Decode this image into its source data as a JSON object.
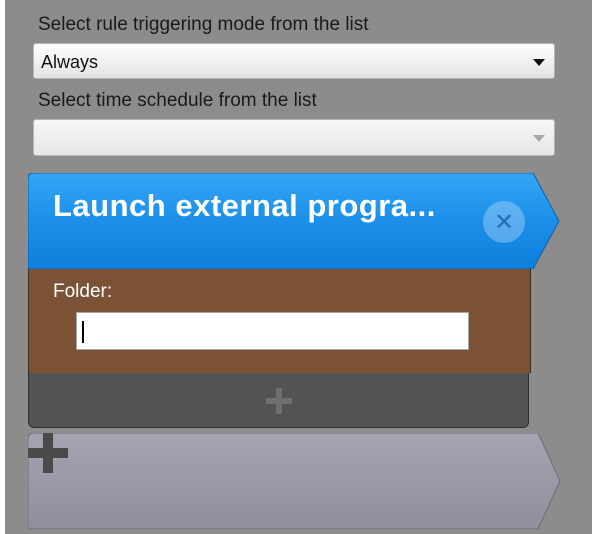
{
  "header": {
    "mode_label": "Select rule triggering mode from the list",
    "schedule_label": "Select time schedule from the list"
  },
  "mode_select": {
    "value": "Always"
  },
  "schedule_select": {
    "value": ""
  },
  "action_card": {
    "title": "Launch external progra...",
    "folder_label": "Folder:",
    "folder_value": ""
  },
  "icons": {
    "close": "close-icon",
    "add_small": "plus-icon",
    "add_big": "plus-icon"
  },
  "colors": {
    "panel": "#8c8c8c",
    "card_header": "#1a8fe8",
    "card_body": "#7b5236",
    "card_footer": "#535353",
    "add_block": "#9a9aa6"
  }
}
